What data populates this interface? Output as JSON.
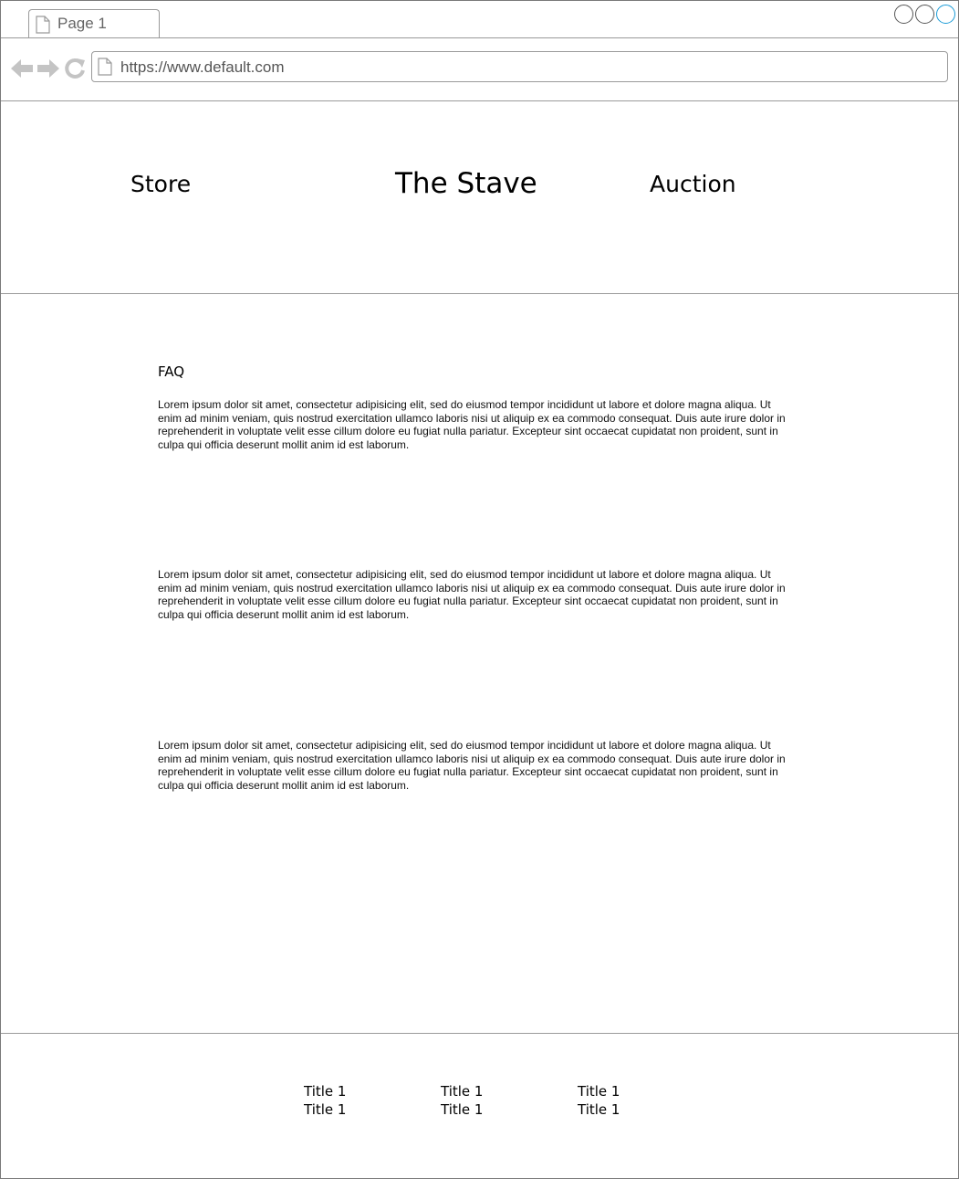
{
  "browser": {
    "tab_label": "Page 1",
    "url": "https://www.default.com",
    "accent_color": "#1a9bd7"
  },
  "header": {
    "store_label": "Store",
    "brand": "The Stave",
    "auction_label": "Auction"
  },
  "content": {
    "faq_title": "FAQ",
    "paragraphs": [
      "Lorem ipsum dolor sit amet, consectetur adipisicing elit, sed do eiusmod tempor incididunt ut labore et dolore magna aliqua. Ut enim ad minim veniam, quis nostrud exercitation ullamco laboris nisi ut aliquip ex ea commodo consequat. Duis aute irure dolor in reprehenderit in voluptate velit esse cillum dolore eu fugiat nulla pariatur. Excepteur sint occaecat cupidatat non proident, sunt in culpa qui officia deserunt mollit anim id est laborum.",
      "Lorem ipsum dolor sit amet, consectetur adipisicing elit, sed do eiusmod tempor incididunt ut labore et dolore magna aliqua. Ut enim ad minim veniam, quis nostrud exercitation ullamco laboris nisi ut aliquip ex ea commodo consequat. Duis aute irure dolor in reprehenderit in voluptate velit esse cillum dolore eu fugiat nulla pariatur. Excepteur sint occaecat cupidatat non proident, sunt in culpa qui officia deserunt mollit anim id est laborum.",
      "Lorem ipsum dolor sit amet, consectetur adipisicing elit, sed do eiusmod tempor incididunt ut labore et dolore magna aliqua. Ut enim ad minim veniam, quis nostrud exercitation ullamco laboris nisi ut aliquip ex ea commodo consequat. Duis aute irure dolor in reprehenderit in voluptate velit esse cillum dolore eu fugiat nulla pariatur. Excepteur sint occaecat cupidatat non proident, sunt in culpa qui officia deserunt mollit anim id est laborum."
    ]
  },
  "footer": {
    "columns": [
      [
        "Title 1",
        "Title 1"
      ],
      [
        "Title 1",
        "Title 1"
      ],
      [
        "Title 1",
        "Title 1"
      ]
    ]
  }
}
